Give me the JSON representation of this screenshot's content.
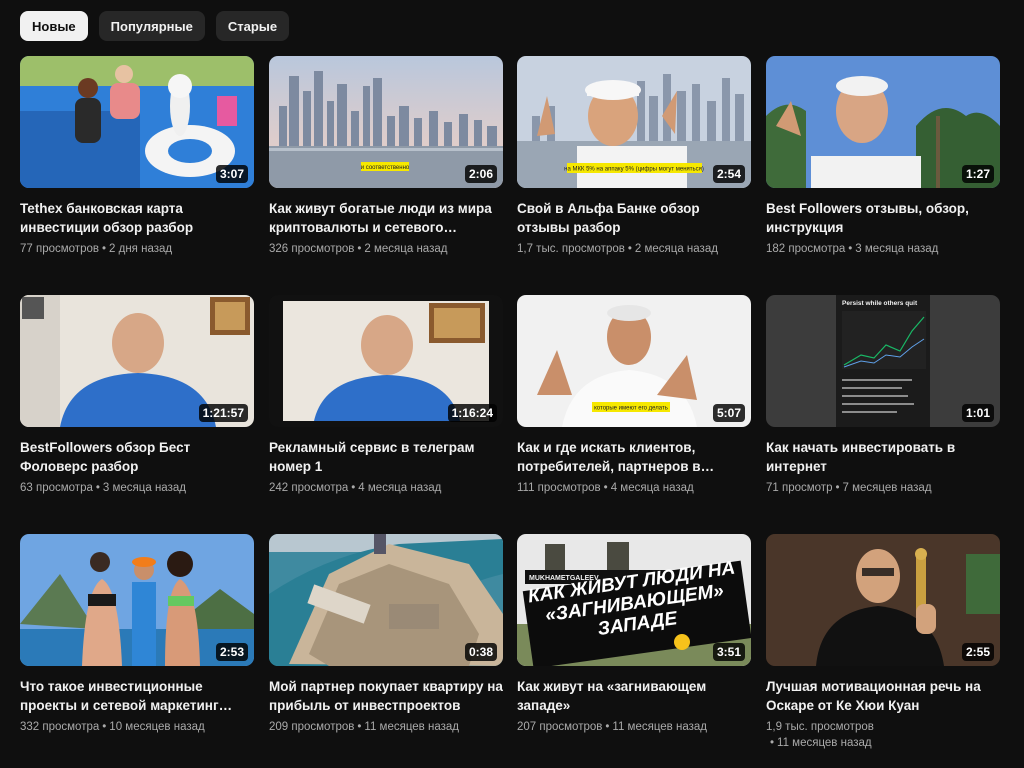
{
  "chips": [
    {
      "label": "Новые",
      "active": true
    },
    {
      "label": "Популярные",
      "active": false
    },
    {
      "label": "Старые",
      "active": false
    }
  ],
  "videos": [
    {
      "title": "Tethex банковская карта инвестиции обзор разбор",
      "views": "77 просмотров",
      "date": "2 дня назад",
      "duration": "3:07",
      "thumb": "pool"
    },
    {
      "title": "Как живут богатые люди из мира криптовалюты и сетевого маркетинга",
      "views": "326 просмотров",
      "date": "2 месяца назад",
      "duration": "2:06",
      "thumb": "skyline",
      "caption": "и соответственно"
    },
    {
      "title": "Свой в Альфа Банке обзор отзывы разбор",
      "views": "1,7 тыс. просмотров",
      "date": "2 месяца назад",
      "duration": "2:54",
      "thumb": "man-city",
      "caption": "на МКК 5% на аппаку 5% (цифры могут меняться)"
    },
    {
      "title": "Best Followers отзывы, обзор, инструкция",
      "views": "182 просмотра",
      "date": "3 месяца назад",
      "duration": "1:27",
      "thumb": "man-palms"
    },
    {
      "title": "BestFollowers обзор Бест Фоловерс разбор",
      "views": "63 просмотра",
      "date": "3 месяца назад",
      "duration": "1:21:57",
      "thumb": "man-room"
    },
    {
      "title": "Рекламный сервис в телеграм номер 1",
      "views": "242 просмотра",
      "date": "4 месяца назад",
      "duration": "1:16:24",
      "thumb": "man-room2"
    },
    {
      "title": "Как и где искать клиентов, потребителей, партнеров в интернете",
      "views": "111 просмотров",
      "date": "4 месяца назад",
      "duration": "5:07",
      "thumb": "man-white",
      "caption": "которые имеют его делать"
    },
    {
      "title": "Как начать инвестировать в интернет",
      "views": "71 просмотр",
      "date": "7 месяцев назад",
      "duration": "1:01",
      "thumb": "chart",
      "caption": "Persist while others quit"
    },
    {
      "title": "Что такое инвестиционные проекты и сетевой маркетинг простыми словами",
      "views": "332 просмотра",
      "date": "10 месяцев назад",
      "duration": "2:53",
      "thumb": "beach"
    },
    {
      "title": "Мой партнер покупает квартиру на прибыль от инвестпроектов",
      "views": "209 просмотров",
      "date": "11 месяцев назад",
      "duration": "0:38",
      "thumb": "island"
    },
    {
      "title": "Как живут на «загнивающем западе»",
      "views": "207 просмотров",
      "date": "11 месяцев назад",
      "duration": "3:51",
      "thumb": "poster",
      "caption": "КАК ЖИВУТ ЛЮДИ НА «ЗАГНИВАЮЩЕМ» ЗАПАДЕ",
      "caption_tag": "MUKHAMETGALEEV"
    },
    {
      "title": "Лучшая мотивационная речь на Оскаре от Ке Хюи Куан",
      "views": "1,9 тыс. просмотров",
      "date": "11 месяцев назад",
      "duration": "2:55",
      "thumb": "oscar",
      "wrap_meta": true
    }
  ],
  "colors": {
    "background": "#0f0f0f",
    "chip": "#272727",
    "chip_active": "#f1f1f1",
    "meta": "#aaaaaa"
  }
}
